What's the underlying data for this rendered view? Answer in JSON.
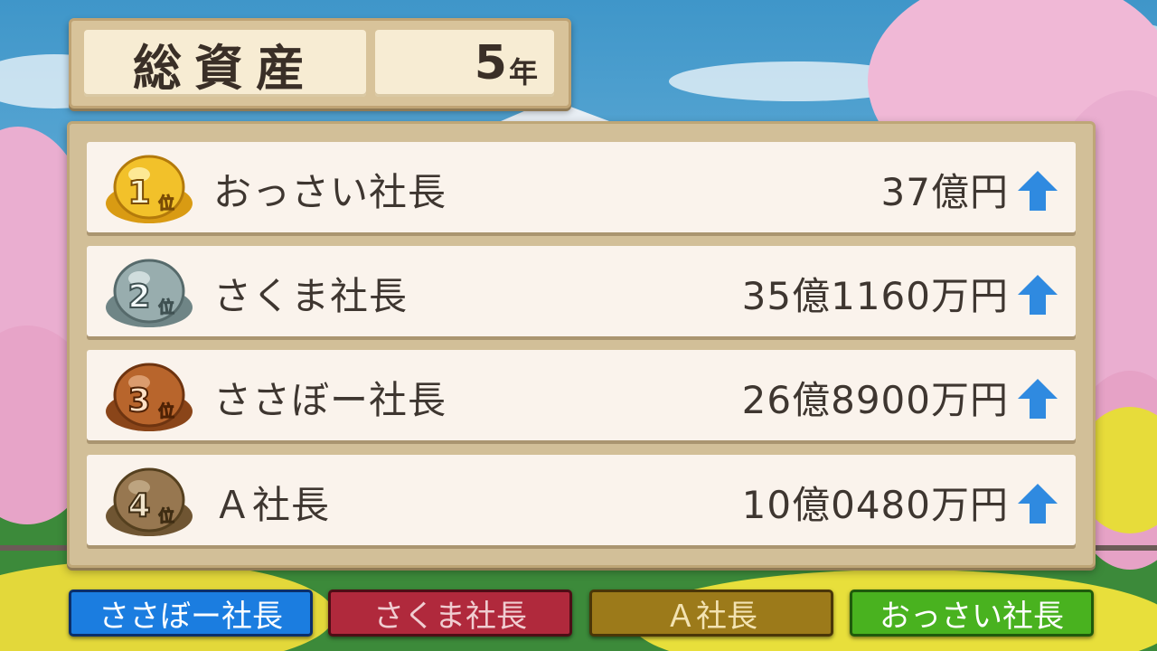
{
  "header": {
    "title": "総資産",
    "year_value": "5",
    "year_unit": "年"
  },
  "rankings": [
    {
      "rank_num": "1",
      "rank_suffix": "位",
      "medal": "gold-medal-icon",
      "name": "おっさい社長",
      "assets": "37億円",
      "trend": "up-arrow-icon"
    },
    {
      "rank_num": "2",
      "rank_suffix": "位",
      "medal": "silver-medal-icon",
      "name": "さくま社長",
      "assets": "35億1160万円",
      "trend": "up-arrow-icon"
    },
    {
      "rank_num": "3",
      "rank_suffix": "位",
      "medal": "bronze-medal-icon",
      "name": "ささぼー社長",
      "assets": "26億8900万円",
      "trend": "up-arrow-icon"
    },
    {
      "rank_num": "4",
      "rank_suffix": "位",
      "medal": "brown-medal-icon",
      "name": "Ａ社長",
      "assets": "10億0480万円",
      "trend": "up-arrow-icon"
    }
  ],
  "players": [
    {
      "name": "ささぼー社長",
      "color": "#1b7de0"
    },
    {
      "name": "さくま社長",
      "color": "#b0293c"
    },
    {
      "name": "Ａ社長",
      "color": "#9c7a1a"
    },
    {
      "name": "おっさい社長",
      "color": "#49b21f"
    }
  ],
  "colors": {
    "gold": "#e8b21c",
    "silver": "#8ea2a3",
    "bronze": "#b0602a",
    "brown": "#8f7048",
    "up_arrow": "#2f8ae0"
  }
}
